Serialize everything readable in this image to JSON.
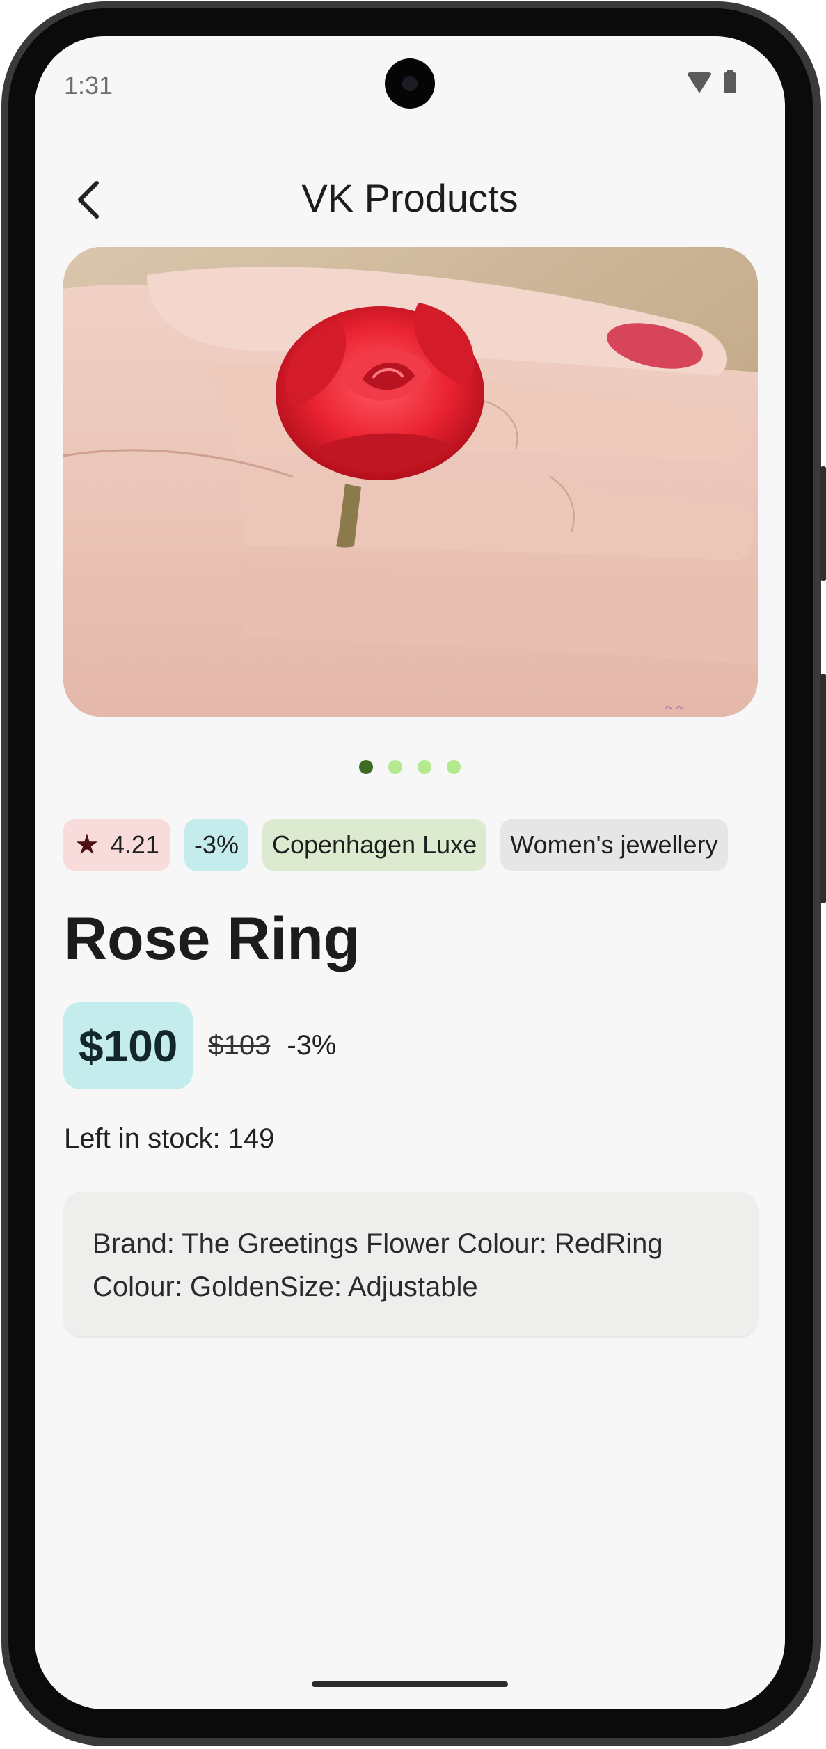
{
  "status_bar": {
    "time": "1:31",
    "icons": [
      "wifi-icon",
      "battery-icon"
    ]
  },
  "header": {
    "title": "VK Products",
    "back_icon": "back-arrow-icon"
  },
  "gallery": {
    "image_description_icon": "product-photo",
    "page_count": 4,
    "active_index": 0
  },
  "chips": {
    "rating": "4.21",
    "rating_icon": "star-icon",
    "discount": "-3%",
    "brand": "Copenhagen Luxe",
    "category": "Women's jewellery"
  },
  "product": {
    "name": "Rose Ring",
    "price": "$100",
    "old_price": "$103",
    "discount": "-3%",
    "stock": "Left in stock: 149",
    "description_line1": "Brand: The Greetings Flower Colour: RedRing",
    "description_line2": "Colour: GoldenSize: Adjustable"
  },
  "colors": {
    "discount_bg": "#c4ecec",
    "rating_bg": "#f8dcdc",
    "brand_bg": "#dcebd0",
    "category_bg": "#e6e6e6",
    "dot_active": "#3d6b23",
    "dot_inactive": "#b5e98f"
  }
}
